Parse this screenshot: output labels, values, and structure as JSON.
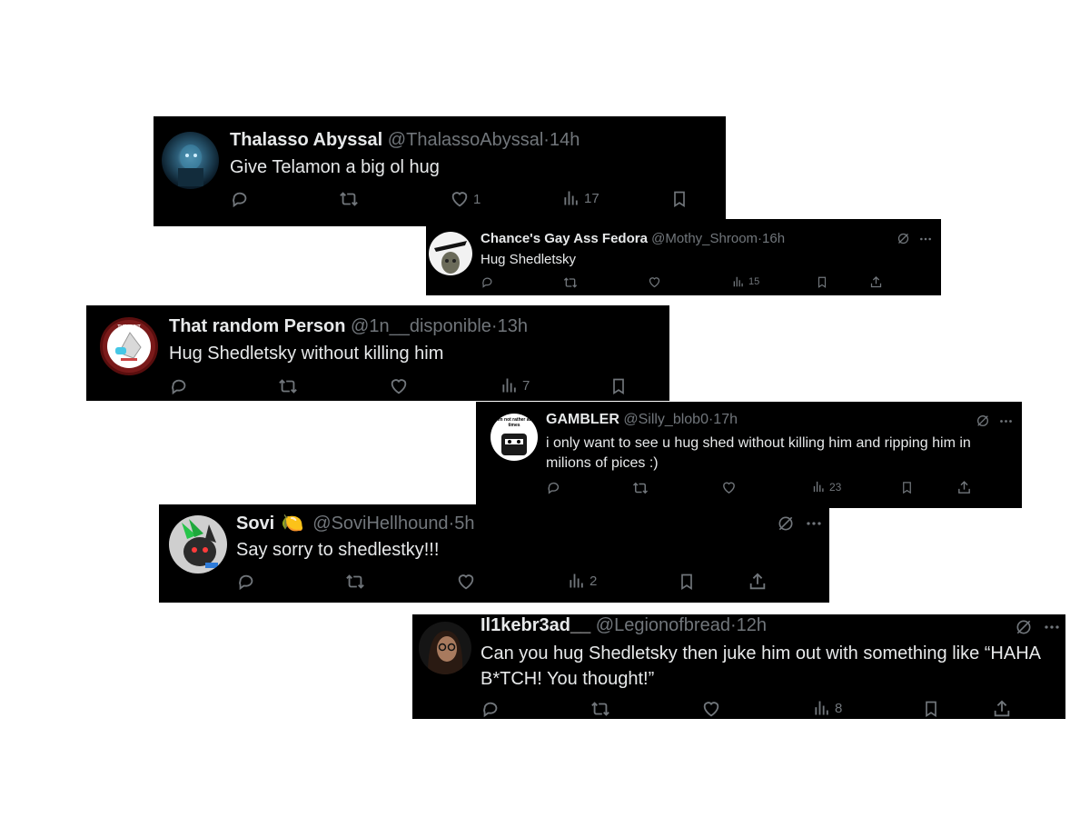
{
  "tweets": [
    {
      "name": "Thalasso Abyssal",
      "badge": "",
      "handle": "@ThalassoAbyssal",
      "sep": "·",
      "time": "14h",
      "text": "Give Telamon a big ol hug",
      "likes": "1",
      "views": "17"
    },
    {
      "name": "Chance's Gay Ass Fedora",
      "badge": "",
      "handle": "@Mothy_Shroom",
      "sep": "·",
      "time": "16h",
      "text": "Hug Shedletsky",
      "likes": "",
      "views": "15"
    },
    {
      "name": "That random Person",
      "badge": "",
      "handle": "@1n__disponible",
      "sep": "·",
      "time": "13h",
      "text": "Hug Shedletsky without killing him",
      "likes": "",
      "views": "7"
    },
    {
      "name": "GAMBLER",
      "badge": "",
      "handle": "@Silly_blob0",
      "sep": "·",
      "time": "17h",
      "text": "i only want to see u hug shed without killing him and ripping him in milions of pices :)",
      "likes": "",
      "views": "23"
    },
    {
      "name": "Sovi",
      "badge": "🍋",
      "handle": "@SoviHellhound",
      "sep": "·",
      "time": "5h",
      "text": "Say sorry to shedlestky!!!",
      "likes": "",
      "views": "2"
    },
    {
      "name": "Il1kebr3ad__",
      "badge": "",
      "handle": "@Legionofbread",
      "sep": "·",
      "time": "12h",
      "text": "Can you hug Shedletsky then juke him out with something like “HAHA B*TCH! You thought!”",
      "likes": "",
      "views": "8"
    }
  ],
  "avatar_text": {
    "t3": "THE HUNT",
    "t4": "im not rather at times"
  },
  "icons": [
    "reply-icon",
    "retweet-icon",
    "like-icon",
    "views-icon",
    "bookmark-icon",
    "share-icon",
    "grok-icon",
    "more-icon"
  ],
  "colors": {
    "card_bg": "#000000",
    "text": "#e7e9ea",
    "muted": "#71767b",
    "page_bg": "#ffffff"
  }
}
